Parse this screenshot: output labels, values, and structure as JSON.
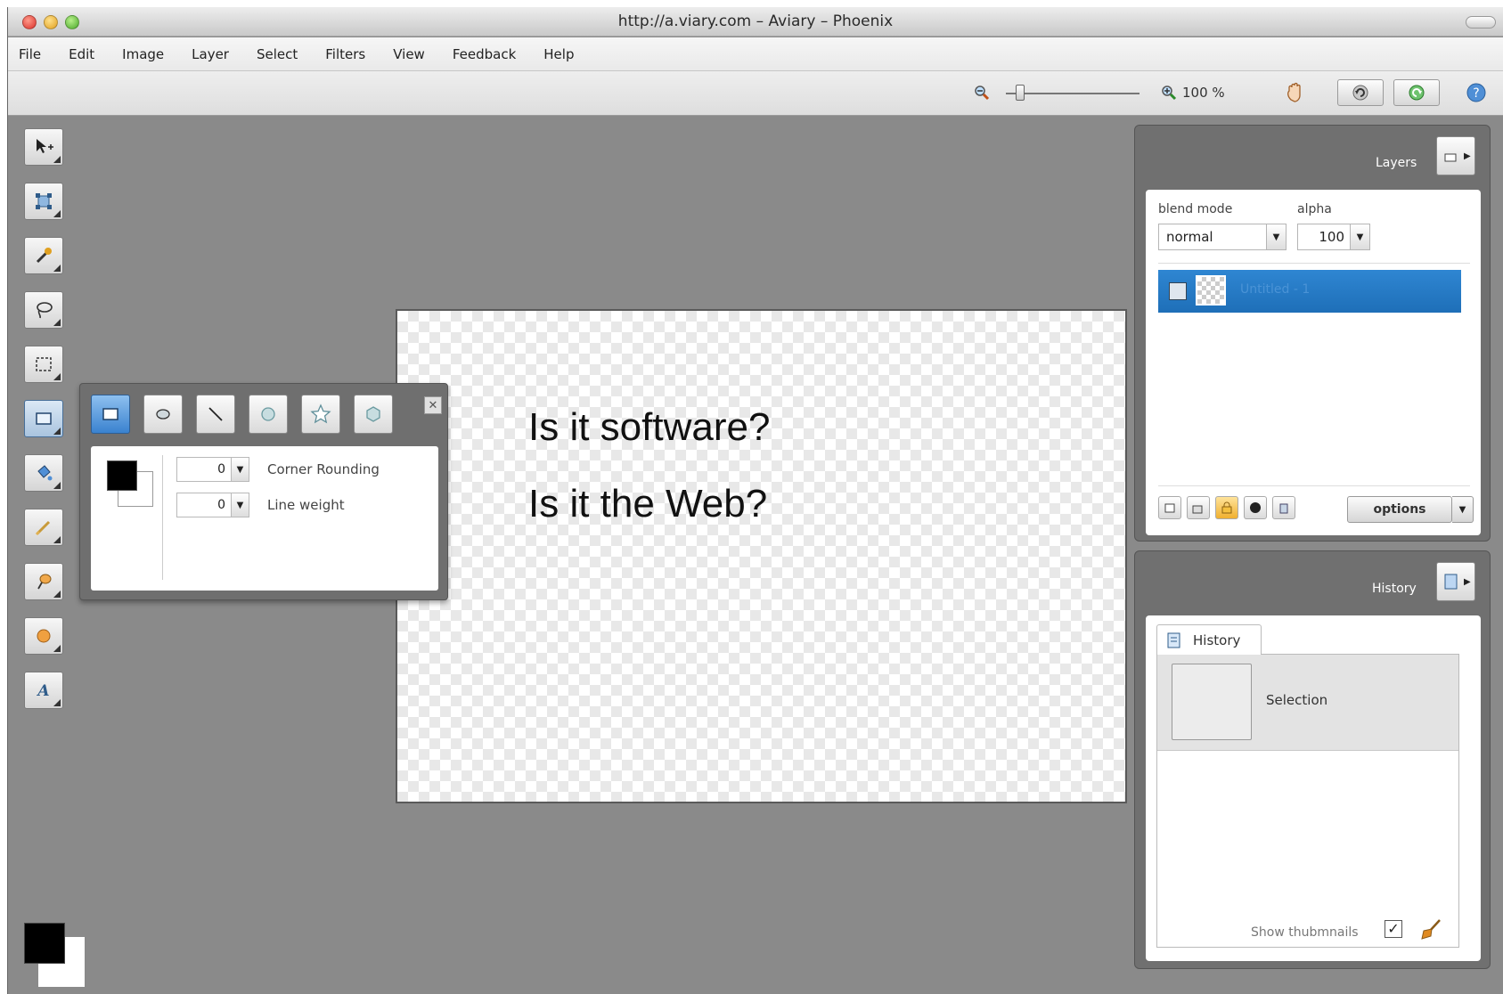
{
  "window": {
    "title": "http://a.viary.com – Aviary – Phoenix"
  },
  "menu": [
    "File",
    "Edit",
    "Image",
    "Layer",
    "Select",
    "Filters",
    "View",
    "Feedback",
    "Help"
  ],
  "toolbar": {
    "zoom_value": "100 %",
    "zoom_level": 0.1
  },
  "tools": [
    "move-tool",
    "transform-tool",
    "color-picker-tool",
    "lasso-tool",
    "marquee-select-tool",
    "shape-tool",
    "fill-tool",
    "brush-tool",
    "eraser-tool",
    "blur-tool",
    "text-tool"
  ],
  "shape_options": {
    "shapes": [
      "rectangle",
      "ellipse",
      "line",
      "circle",
      "star",
      "polygon"
    ],
    "corner_rounding_value": "0",
    "corner_rounding_label": "Corner Rounding",
    "line_weight_value": "0",
    "line_weight_label": "Line weight"
  },
  "canvas": {
    "line1": "Is it software?",
    "line2": "Is it the Web?"
  },
  "layers_panel": {
    "title": "Layers",
    "blend_mode_label": "blend mode",
    "blend_mode_value": "normal",
    "alpha_label": "alpha",
    "alpha_value": "100",
    "layer_name": "Untitled - 1",
    "options_label": "options"
  },
  "history_panel": {
    "title": "History",
    "tab_label": "History",
    "entry": "Selection",
    "show_thumbnails_label": "Show thubmnails",
    "show_thumbnails_checked": true,
    "checkmark": "✓"
  },
  "colors": {
    "foreground": "#000000",
    "background": "#ffffff",
    "selection": "#1e6fb8"
  }
}
